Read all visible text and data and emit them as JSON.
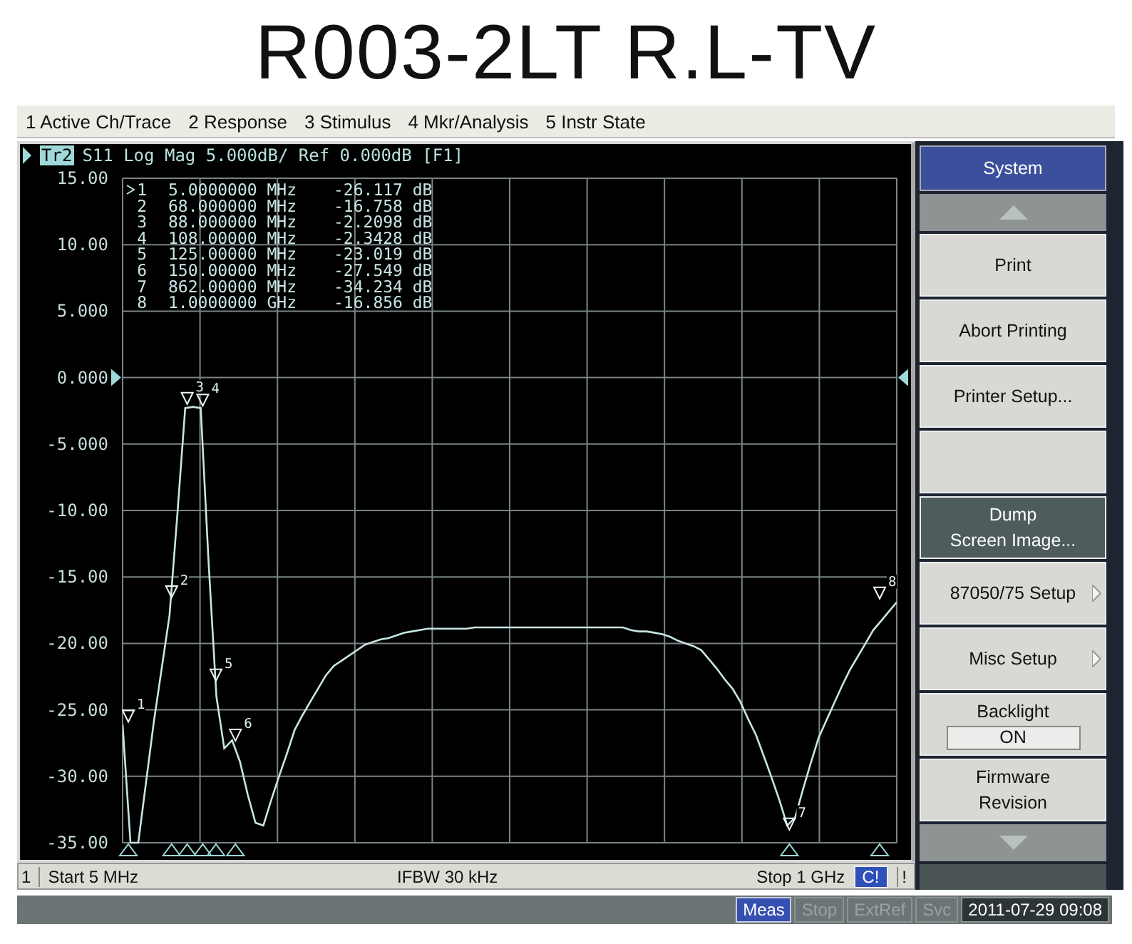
{
  "title": "R003-2LT R.L-TV",
  "menu": [
    {
      "label": "1 Active Ch/Trace"
    },
    {
      "label": "2 Response"
    },
    {
      "label": "3 Stimulus"
    },
    {
      "label": "4 Mkr/Analysis"
    },
    {
      "label": "5 Instr State"
    }
  ],
  "trace_header": {
    "trace": "Tr2",
    "selected": true,
    "text": "S11 Log Mag 5.000dB/ Ref 0.000dB [F1]"
  },
  "markers": [
    {
      "number": "1",
      "flag_label": "1",
      "active": true,
      "frequency": "5.0000000 MHz",
      "value": "-26.117 dB"
    },
    {
      "number": "2",
      "flag_label": "2",
      "active": false,
      "frequency": "68.000000 MHz",
      "value": "-16.758 dB"
    },
    {
      "number": "3",
      "flag_label": "3",
      "active": false,
      "frequency": "88.000000 MHz",
      "value": "-2.2098 dB"
    },
    {
      "number": "4",
      "flag_label": "4",
      "active": false,
      "frequency": "108.00000 MHz",
      "value": "-2.3428 dB"
    },
    {
      "number": "5",
      "flag_label": "5",
      "active": false,
      "frequency": "125.00000 MHz",
      "value": "-23.019 dB"
    },
    {
      "number": "6",
      "flag_label": "6",
      "active": false,
      "frequency": "150.00000 MHz",
      "value": "-27.549 dB"
    },
    {
      "number": "7",
      "flag_label": "7",
      "active": false,
      "frequency": "862.00000 MHz",
      "value": "-34.234 dB"
    },
    {
      "number": "8",
      "flag_label": "8",
      "active": false,
      "frequency": "1.0000000 GHz",
      "value": "-16.856 dB"
    }
  ],
  "chart_data": {
    "type": "line",
    "grid": true,
    "ylim": [
      -35,
      15
    ],
    "yticks": [
      {
        "value": 15,
        "label": "15.00"
      },
      {
        "value": 10,
        "label": "10.00"
      },
      {
        "value": 5,
        "label": "5.000"
      },
      {
        "value": 0,
        "label": "0.000"
      },
      {
        "value": -5,
        "label": "-5.000"
      },
      {
        "value": -10,
        "label": "-10.00"
      },
      {
        "value": -15,
        "label": "-15.00"
      },
      {
        "value": -20,
        "label": "-20.00"
      },
      {
        "value": -25,
        "label": "-25.00"
      },
      {
        "value": -30,
        "label": "-30.00"
      },
      {
        "value": -35,
        "label": "-35.00"
      }
    ],
    "categories": [
      null,
      null,
      null,
      null,
      null,
      null,
      null,
      null,
      null,
      null,
      null,
      null,
      null,
      null,
      null,
      null,
      null,
      null,
      null,
      null,
      null,
      null,
      null,
      null,
      null,
      null,
      null,
      null,
      null,
      null,
      null,
      null,
      null,
      null,
      null,
      null,
      null,
      null,
      null,
      null,
      null,
      null,
      null,
      null,
      null,
      null,
      null,
      null,
      null,
      null,
      null,
      null,
      null,
      null,
      null,
      null,
      null,
      null,
      null,
      null,
      null,
      null,
      null,
      null,
      null,
      null,
      null,
      null,
      null,
      null,
      null,
      null,
      null,
      null,
      null,
      null,
      null,
      null,
      null,
      null,
      null,
      null,
      null,
      null,
      null,
      null,
      null,
      null,
      null,
      null,
      null,
      null,
      null,
      null,
      null,
      null,
      null,
      null,
      null,
      null
    ],
    "series": [
      {
        "color": "#c8e4e4",
        "values": [
          -26.1,
          -35,
          -35,
          -30.4,
          -25.9,
          -21.9,
          -17.9,
          -10.3,
          -2.3,
          -2.2,
          -2.3,
          -13.9,
          -24,
          -27.9,
          -27.3,
          -28.9,
          -31.4,
          -33.5,
          -33.7,
          -31.8,
          -30,
          -28.3,
          -26.5,
          -25.4,
          -24.4,
          -23.4,
          -22.4,
          -21.7,
          -21.3,
          -20.9,
          -20.5,
          -20.1,
          -19.9,
          -19.7,
          -19.6,
          -19.4,
          -19.2,
          -19.1,
          -19,
          -18.9,
          -18.9,
          -18.9,
          -18.9,
          -18.9,
          -18.9,
          -18.8,
          -18.8,
          -18.8,
          -18.8,
          -18.8,
          -18.8,
          -18.8,
          -18.8,
          -18.8,
          -18.8,
          -18.8,
          -18.8,
          -18.8,
          -18.8,
          -18.8,
          -18.8,
          -18.8,
          -18.8,
          -18.8,
          -18.8,
          -19,
          -19.1,
          -19.1,
          -19.2,
          -19.3,
          -19.5,
          -19.8,
          -20,
          -20.2,
          -20.5,
          -21.2,
          -21.9,
          -22.7,
          -23.4,
          -24.4,
          -25.7,
          -26.9,
          -28.5,
          -30.1,
          -31.8,
          -33.7,
          -33.1,
          -31,
          -29,
          -27.1,
          -25.8,
          -24.5,
          -23.2,
          -22,
          -21,
          -20,
          -19,
          -18.3,
          -17.6,
          -16.9
        ]
      }
    ]
  },
  "softkeys": [
    {
      "kind": "header",
      "label": "System"
    },
    {
      "kind": "scroll-up"
    },
    {
      "kind": "key",
      "label": "Print",
      "selected": false,
      "submenu": false
    },
    {
      "kind": "key",
      "label": "Abort Printing",
      "selected": false,
      "submenu": false
    },
    {
      "kind": "key",
      "label": "Printer Setup...",
      "selected": false,
      "submenu": false
    },
    {
      "kind": "blank"
    },
    {
      "kind": "key",
      "label": "Dump\nScreen Image...",
      "selected": true,
      "submenu": false
    },
    {
      "kind": "key",
      "label": "87050/75 Setup",
      "selected": false,
      "submenu": true
    },
    {
      "kind": "key",
      "label": "Misc Setup",
      "selected": false,
      "submenu": true
    },
    {
      "kind": "toggle",
      "label": "Backlight",
      "value": "ON"
    },
    {
      "kind": "key",
      "label": "Firmware\nRevision",
      "selected": false,
      "submenu": false
    },
    {
      "kind": "scroll-down"
    }
  ],
  "status_line": {
    "channel": "1",
    "start": "Start 5 MHz",
    "ifbw": "IFBW 30 kHz",
    "stop": "Stop 1 GHz",
    "correction": "C!",
    "flag": "!"
  },
  "bottom_bar": {
    "indicators": [
      {
        "label": "Meas",
        "on": true
      },
      {
        "label": "Stop",
        "on": false
      },
      {
        "label": "ExtRef",
        "on": false
      },
      {
        "label": "Svc",
        "on": false
      }
    ],
    "datetime": "2011-07-29 09:08"
  }
}
